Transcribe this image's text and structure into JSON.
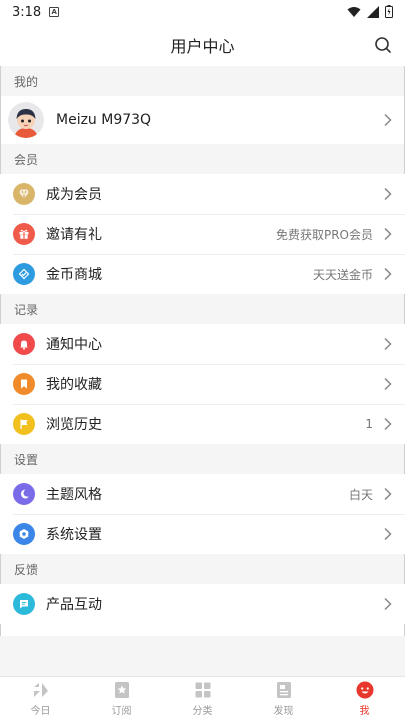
{
  "status_bar": {
    "time": "3:18"
  },
  "header": {
    "title": "用户中心"
  },
  "sections": {
    "mine": {
      "title": "我的",
      "profile_name": "Meizu M973Q"
    },
    "member": {
      "title": "会员",
      "items": [
        {
          "label": "成为会员",
          "value": "",
          "icon": "member-diamond-icon",
          "color": "#d9b56a"
        },
        {
          "label": "邀请有礼",
          "value": "免费获取PRO会员",
          "icon": "gift-icon",
          "color": "#f05a4a"
        },
        {
          "label": "金币商城",
          "value": "天天送金币",
          "icon": "coin-mall-icon",
          "color": "#2d9be0"
        }
      ]
    },
    "record": {
      "title": "记录",
      "items": [
        {
          "label": "通知中心",
          "value": "",
          "icon": "bell-icon",
          "color": "#f04a4a"
        },
        {
          "label": "我的收藏",
          "value": "",
          "icon": "bookmark-icon",
          "color": "#f08a2a"
        },
        {
          "label": "浏览历史",
          "value": "1",
          "icon": "flag-icon",
          "color": "#f2c01e"
        }
      ]
    },
    "settings": {
      "title": "设置",
      "items": [
        {
          "label": "主题风格",
          "value": "白天",
          "icon": "moon-icon",
          "color": "#7a6be8"
        },
        {
          "label": "系统设置",
          "value": "",
          "icon": "settings-hex-icon",
          "color": "#3b86e6"
        }
      ]
    },
    "feedback": {
      "title": "反馈",
      "items": [
        {
          "label": "产品互动",
          "value": "",
          "icon": "chat-icon",
          "color": "#2db9d9"
        }
      ]
    }
  },
  "tabs": [
    {
      "label": "今日",
      "icon": "today-icon",
      "active": false
    },
    {
      "label": "订阅",
      "icon": "subscribe-icon",
      "active": false
    },
    {
      "label": "分类",
      "icon": "category-icon",
      "active": false
    },
    {
      "label": "发现",
      "icon": "discover-icon",
      "active": false
    },
    {
      "label": "我",
      "icon": "me-icon",
      "active": true
    }
  ],
  "colors": {
    "accent": "#e8372c",
    "section_bg": "#f5f5f5"
  }
}
